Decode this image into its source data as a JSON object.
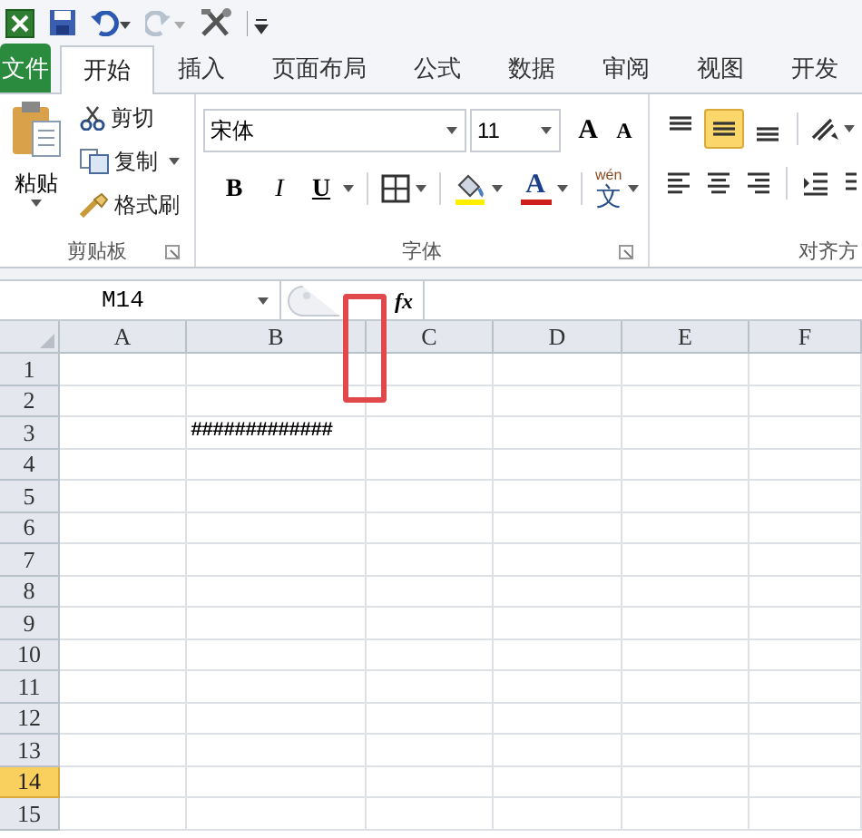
{
  "tabs": [
    {
      "label": "文件",
      "kind": "file",
      "selected": false
    },
    {
      "label": "开始",
      "kind": "tab",
      "selected": true
    },
    {
      "label": "插入",
      "kind": "tab",
      "selected": false
    },
    {
      "label": "页面布局",
      "kind": "tab",
      "selected": false
    },
    {
      "label": "公式",
      "kind": "tab",
      "selected": false
    },
    {
      "label": "数据",
      "kind": "tab",
      "selected": false
    },
    {
      "label": "审阅",
      "kind": "tab",
      "selected": false
    },
    {
      "label": "视图",
      "kind": "tab",
      "selected": false
    },
    {
      "label": "开发",
      "kind": "tab",
      "selected": false
    }
  ],
  "ribbon": {
    "clipboard": {
      "paste": "粘贴",
      "cut": "剪切",
      "copy": "复制",
      "format_painter": "格式刷",
      "label": "剪贴板"
    },
    "font": {
      "font_name": "宋体",
      "font_size": "11",
      "grow": "A",
      "shrink": "A",
      "bold": "B",
      "italic": "I",
      "underline": "U",
      "font_color": "A",
      "phonetic_ruby": "wén",
      "phonetic_char": "文",
      "label": "字体"
    },
    "alignment": {
      "label": "对齐方",
      "vertical": [
        {
          "kind": "top",
          "selected": false
        },
        {
          "kind": "middle",
          "selected": true
        },
        {
          "kind": "bottom",
          "selected": false
        }
      ]
    }
  },
  "name_box": "M14",
  "formula_bar": {
    "fx": "fx"
  },
  "columns": [
    "A",
    "B",
    "C",
    "D",
    "E",
    "F"
  ],
  "rows": [
    {
      "header": "1",
      "selected": false
    },
    {
      "header": "2",
      "selected": false
    },
    {
      "header": "3",
      "selected": false,
      "cells": [
        null,
        "#############",
        null,
        null,
        null,
        null
      ]
    },
    {
      "header": "4",
      "selected": false
    },
    {
      "header": "5",
      "selected": false
    },
    {
      "header": "6",
      "selected": false
    },
    {
      "header": "7",
      "selected": false
    },
    {
      "header": "8",
      "selected": false
    },
    {
      "header": "9",
      "selected": false
    },
    {
      "header": "10",
      "selected": false
    },
    {
      "header": "11",
      "selected": false
    },
    {
      "header": "12",
      "selected": false
    },
    {
      "header": "13",
      "selected": false
    },
    {
      "header": "14",
      "selected": true
    },
    {
      "header": "15",
      "selected": false
    }
  ]
}
